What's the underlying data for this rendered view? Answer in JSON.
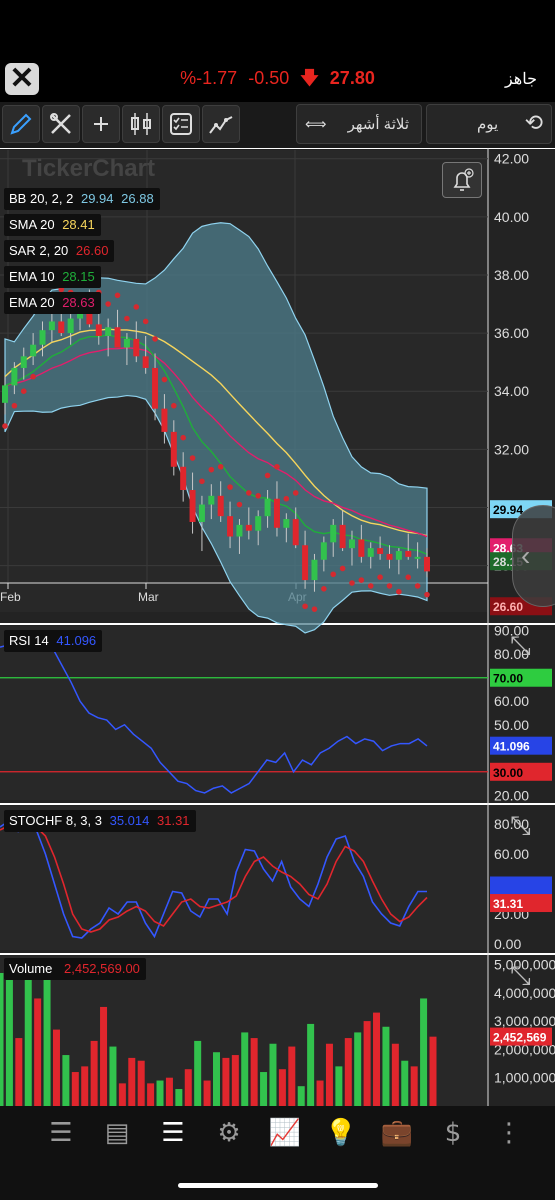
{
  "header": {
    "status": "جاهز",
    "price": "27.80",
    "change": "-0.50",
    "change_pct": "%-1.77",
    "close_icon": "close-icon",
    "down_arrow_icon": "arrow-down-icon"
  },
  "toolbar": {
    "period_label": "ثلاثة أشهر",
    "interval_label": "يوم",
    "tools": [
      "pencil-icon",
      "tools-icon",
      "crosshair-icon",
      "candlestick-icon",
      "checklist-icon",
      "trend-icon"
    ]
  },
  "chart_data": [
    {
      "type": "candlestick",
      "watermark": "TickerChart",
      "x_labels": [
        "Feb",
        "Mar",
        "Apr"
      ],
      "y_ticks": [
        "42.00",
        "40.00",
        "38.00",
        "36.00",
        "34.00",
        "32.00",
        "30.00",
        "28.00"
      ],
      "ylim": [
        27.4,
        42.3
      ],
      "indicators": [
        {
          "name": "BB",
          "params": "20, 2, 2",
          "values": [
            "29.94",
            "26.88"
          ],
          "colors": [
            "#7ec8e3",
            "#7ec8e3"
          ]
        },
        {
          "name": "SMA",
          "params": "20",
          "values": [
            "28.41"
          ],
          "colors": [
            "#f6d55c"
          ]
        },
        {
          "name": "SAR",
          "params": "2, 20",
          "values": [
            "26.60"
          ],
          "colors": [
            "#e0262d"
          ]
        },
        {
          "name": "EMA",
          "params": "10",
          "values": [
            "28.15"
          ],
          "colors": [
            "#1fae3a"
          ]
        },
        {
          "name": "EMA",
          "params": "20",
          "values": [
            "28.63"
          ],
          "colors": [
            "#e21e6c"
          ]
        }
      ],
      "price_tags": [
        {
          "label": "29.94",
          "value": 29.94,
          "color": "#7ed6f5",
          "text": "#000"
        },
        {
          "label": "28.63",
          "value": 28.63,
          "color": "#e21e6c",
          "text": "#fff"
        },
        {
          "label": "28.15",
          "value": 28.15,
          "color": "#1e6b2a",
          "text": "#ddd"
        },
        {
          "label": "26.60",
          "value": 26.6,
          "color": "#8b0f14",
          "text": "#ffb0b0"
        }
      ],
      "candles_ohlc": [
        [
          33.6,
          34.5,
          33.2,
          34.2
        ],
        [
          34.2,
          35.0,
          33.9,
          34.8
        ],
        [
          34.8,
          35.5,
          34.4,
          35.2
        ],
        [
          35.2,
          36.0,
          34.9,
          35.6
        ],
        [
          35.6,
          36.4,
          35.2,
          36.1
        ],
        [
          36.1,
          36.8,
          35.7,
          36.4
        ],
        [
          36.4,
          37.0,
          35.9,
          36.0
        ],
        [
          36.0,
          36.9,
          35.6,
          36.5
        ],
        [
          36.5,
          37.2,
          36.1,
          36.8
        ],
        [
          36.8,
          37.5,
          36.2,
          36.3
        ],
        [
          36.3,
          36.9,
          35.6,
          35.9
        ],
        [
          35.9,
          36.5,
          35.2,
          36.2
        ],
        [
          36.2,
          36.8,
          35.8,
          35.5
        ],
        [
          35.5,
          36.0,
          34.9,
          35.8
        ],
        [
          35.8,
          36.4,
          35.0,
          35.2
        ],
        [
          35.2,
          35.9,
          34.6,
          34.8
        ],
        [
          34.8,
          35.3,
          33.0,
          33.4
        ],
        [
          33.4,
          33.9,
          32.2,
          32.6
        ],
        [
          32.6,
          33.0,
          31.1,
          31.4
        ],
        [
          31.4,
          31.9,
          30.2,
          30.6
        ],
        [
          30.6,
          31.2,
          29.1,
          29.5
        ],
        [
          29.5,
          30.4,
          28.5,
          30.1
        ],
        [
          30.1,
          30.8,
          29.6,
          30.4
        ],
        [
          30.4,
          30.9,
          29.5,
          29.7
        ],
        [
          29.7,
          30.2,
          28.6,
          29.0
        ],
        [
          29.0,
          29.6,
          28.4,
          29.4
        ],
        [
          29.4,
          30.0,
          28.9,
          29.2
        ],
        [
          29.2,
          29.9,
          28.7,
          29.7
        ],
        [
          29.7,
          30.6,
          29.3,
          30.3
        ],
        [
          30.3,
          30.9,
          29.0,
          29.3
        ],
        [
          29.3,
          29.8,
          28.8,
          29.6
        ],
        [
          29.6,
          30.0,
          28.6,
          28.7
        ],
        [
          28.7,
          29.2,
          27.2,
          27.5
        ],
        [
          27.5,
          28.4,
          27.1,
          28.2
        ],
        [
          28.2,
          29.0,
          27.8,
          28.8
        ],
        [
          28.8,
          29.6,
          28.3,
          29.4
        ],
        [
          29.4,
          29.9,
          28.5,
          28.6
        ],
        [
          28.6,
          29.2,
          28.0,
          28.9
        ],
        [
          28.9,
          29.4,
          28.1,
          28.3
        ],
        [
          28.3,
          28.8,
          27.9,
          28.6
        ],
        [
          28.6,
          29.0,
          28.2,
          28.4
        ],
        [
          28.4,
          28.7,
          27.9,
          28.2
        ],
        [
          28.2,
          28.6,
          27.7,
          28.5
        ],
        [
          28.5,
          29.1,
          28.2,
          28.3
        ],
        [
          28.3,
          28.8,
          27.9,
          28.3
        ],
        [
          28.3,
          28.6,
          27.6,
          27.8
        ]
      ]
    },
    {
      "type": "line",
      "name": "RSI",
      "params": "14",
      "value_label": "41.096",
      "y_ticks": [
        "90.00",
        "80.00",
        "70.00",
        "60.00",
        "50.00",
        "40.00",
        "30.00",
        "20.00"
      ],
      "ylim": [
        18,
        92
      ],
      "levels": [
        {
          "label": "70.00",
          "value": 70,
          "color": "#2ecc40"
        },
        {
          "label": "30.00",
          "value": 30,
          "color": "#e0262d"
        }
      ],
      "value_tag": {
        "label": "41.096",
        "value": 41.1,
        "color": "#2744e6"
      },
      "series": [
        {
          "values": [
            83,
            84,
            86,
            85,
            87,
            86,
            82,
            75,
            68,
            60,
            55,
            53,
            52,
            48,
            50,
            46,
            43,
            40,
            34,
            30,
            26,
            25,
            22,
            21,
            23,
            24,
            21,
            23,
            25,
            30,
            35,
            34,
            38,
            30,
            35,
            33,
            38,
            40,
            43,
            45,
            42,
            44,
            43,
            39,
            41,
            42,
            42,
            44,
            41
          ]
        }
      ]
    },
    {
      "type": "line",
      "name": "STOCHF",
      "params": "8, 3, 3",
      "values": [
        "35.014",
        "31.31"
      ],
      "y_ticks": [
        "80.00",
        "60.00",
        "40.00",
        "20.00",
        "0.00"
      ],
      "ylim": [
        -4,
        92
      ],
      "value_tags": [
        {
          "label": "35.014",
          "value": 35.0,
          "color": "#2744e6"
        },
        {
          "label": "31.31",
          "value": 31.31,
          "color": "#e0262d"
        }
      ],
      "series": [
        {
          "name": "fast",
          "color": "#3457ff",
          "values": [
            78,
            82,
            75,
            80,
            76,
            60,
            40,
            20,
            5,
            4,
            10,
            14,
            24,
            20,
            28,
            28,
            14,
            5,
            20,
            35,
            34,
            22,
            18,
            30,
            30,
            20,
            48,
            63,
            62,
            50,
            42,
            55,
            38,
            30,
            25,
            40,
            58,
            70,
            72,
            55,
            45,
            28,
            20,
            14,
            12,
            25,
            35,
            35
          ]
        },
        {
          "name": "slow",
          "color": "#e0262d",
          "values": [
            76,
            79,
            78,
            78,
            78,
            72,
            58,
            40,
            20,
            10,
            8,
            10,
            16,
            18,
            22,
            25,
            22,
            15,
            12,
            20,
            28,
            30,
            25,
            24,
            26,
            28,
            32,
            45,
            55,
            58,
            52,
            48,
            45,
            40,
            33,
            30,
            40,
            55,
            65,
            62,
            55,
            42,
            30,
            20,
            15,
            18,
            25,
            31
          ]
        }
      ]
    },
    {
      "type": "bar",
      "name": "Volume",
      "value_label": "2,452,569.00",
      "y_ticks": [
        "5,000,000",
        "4,000,000",
        "3,000,000",
        "2,000,000",
        "1,000,000"
      ],
      "ylim": [
        0,
        5300000
      ],
      "value_tag": {
        "label": "2,452,569",
        "value": 2452569,
        "color": "#e0262d"
      },
      "bars": [
        [
          4700000,
          "g"
        ],
        [
          4800000,
          "g"
        ],
        [
          2400000,
          "r"
        ],
        [
          5000000,
          "g"
        ],
        [
          3800000,
          "r"
        ],
        [
          4900000,
          "g"
        ],
        [
          2700000,
          "r"
        ],
        [
          1800000,
          "g"
        ],
        [
          1200000,
          "r"
        ],
        [
          1400000,
          "r"
        ],
        [
          2300000,
          "r"
        ],
        [
          3500000,
          "r"
        ],
        [
          2100000,
          "g"
        ],
        [
          800000,
          "r"
        ],
        [
          1700000,
          "r"
        ],
        [
          1600000,
          "r"
        ],
        [
          800000,
          "r"
        ],
        [
          900000,
          "g"
        ],
        [
          1000000,
          "r"
        ],
        [
          600000,
          "g"
        ],
        [
          1300000,
          "r"
        ],
        [
          2300000,
          "g"
        ],
        [
          900000,
          "r"
        ],
        [
          1900000,
          "g"
        ],
        [
          1700000,
          "r"
        ],
        [
          1800000,
          "r"
        ],
        [
          2600000,
          "g"
        ],
        [
          2400000,
          "r"
        ],
        [
          1200000,
          "g"
        ],
        [
          2200000,
          "g"
        ],
        [
          1300000,
          "r"
        ],
        [
          2100000,
          "r"
        ],
        [
          700000,
          "g"
        ],
        [
          2900000,
          "g"
        ],
        [
          900000,
          "r"
        ],
        [
          2200000,
          "r"
        ],
        [
          1400000,
          "g"
        ],
        [
          2400000,
          "r"
        ],
        [
          2600000,
          "g"
        ],
        [
          3000000,
          "r"
        ],
        [
          3300000,
          "r"
        ],
        [
          2800000,
          "g"
        ],
        [
          2200000,
          "r"
        ],
        [
          1600000,
          "g"
        ],
        [
          1400000,
          "r"
        ],
        [
          3800000,
          "g"
        ],
        [
          2450000,
          "r"
        ]
      ]
    }
  ],
  "bottom_nav": [
    "watchlist-icon",
    "list-icon",
    "orderbook-icon",
    "scanner-icon",
    "chart-icon",
    "idea-icon",
    "portfolio-icon",
    "currency-icon",
    "more-icon"
  ],
  "colors": {
    "up": "#32c24d",
    "down": "#e0262d",
    "panel_bg": "#282828",
    "bb_fill": "#4d7d8c"
  }
}
